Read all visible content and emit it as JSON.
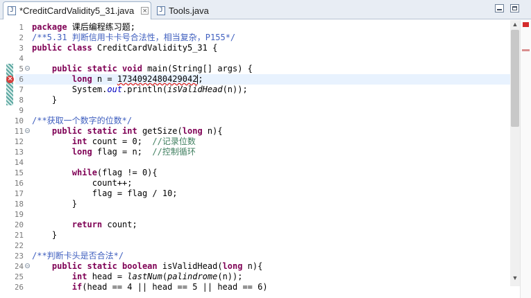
{
  "tabs": [
    {
      "icon": "java-file-icon",
      "label": "*CreditCardValidity5_31.java",
      "active": true
    },
    {
      "icon": "java-file-icon",
      "label": "Tools.java",
      "active": false
    }
  ],
  "editor": {
    "lines": [
      {
        "n": "1",
        "html": "<span class=\"kw\">package</span> 课后编程练习题;"
      },
      {
        "n": "2",
        "html": "<span class=\"jdoc\">/**5.31 判断信用卡卡号合法性，相当复杂，P155*/</span>"
      },
      {
        "n": "3",
        "html": "<span class=\"kw\">public class</span> CreditCardValidity5_31 {"
      },
      {
        "n": "4",
        "html": ""
      },
      {
        "n": "5",
        "fold": true,
        "html": "    <span class=\"kw\">public static void</span> main(String[] args) {"
      },
      {
        "n": "6",
        "current": true,
        "html": "        <span class=\"kw\">long</span> n = <span class=\"err\">1734092480429042</span><span class=\"caret\"></span>;"
      },
      {
        "n": "7",
        "html": "        System.<span class=\"fld\">out</span>.println(<span class=\"ital\">isValidHead</span>(n));"
      },
      {
        "n": "8",
        "html": "    }"
      },
      {
        "n": "9",
        "html": ""
      },
      {
        "n": "10",
        "html": "<span class=\"jdoc\">/**获取一个数字的位数*/</span>"
      },
      {
        "n": "11",
        "fold": true,
        "html": "    <span class=\"kw\">public static int</span> getSize(<span class=\"kw\">long</span> n){"
      },
      {
        "n": "12",
        "html": "        <span class=\"kw\">int</span> count = 0;  <span class=\"cmt\">//记录位数</span>"
      },
      {
        "n": "13",
        "html": "        <span class=\"kw\">long</span> flag = n;  <span class=\"cmt\">//控制循环</span>"
      },
      {
        "n": "14",
        "html": ""
      },
      {
        "n": "15",
        "html": "        <span class=\"kw\">while</span>(flag != 0){"
      },
      {
        "n": "16",
        "html": "            count++;"
      },
      {
        "n": "17",
        "html": "            flag = flag / 10;"
      },
      {
        "n": "18",
        "html": "        }"
      },
      {
        "n": "19",
        "html": ""
      },
      {
        "n": "20",
        "html": "        <span class=\"kw\">return</span> count;"
      },
      {
        "n": "21",
        "html": "    }"
      },
      {
        "n": "22",
        "html": ""
      },
      {
        "n": "23",
        "html": "<span class=\"jdoc\">/**判断卡头是否合法*/</span>"
      },
      {
        "n": "24",
        "fold": true,
        "html": "    <span class=\"kw\">public static boolean</span> isValidHead(<span class=\"kw\">long</span> n){"
      },
      {
        "n": "25",
        "html": "        <span class=\"kw\">int</span> head = <span class=\"ital\">lastNum</span>(<span class=\"ital\">palindrome</span>(n));"
      },
      {
        "n": "26",
        "html": "        <span class=\"kw\">if</span>(head == 4 || head == 5 || head == 6)"
      }
    ],
    "error_line": 6,
    "changed_lines": [
      5,
      6,
      7,
      8
    ]
  },
  "colors": {
    "keyword": "#7f0055",
    "javadoc": "#3f5fbf",
    "comment": "#3f7f5f",
    "error": "#d4413f",
    "current_line": "#e8f2fe"
  }
}
